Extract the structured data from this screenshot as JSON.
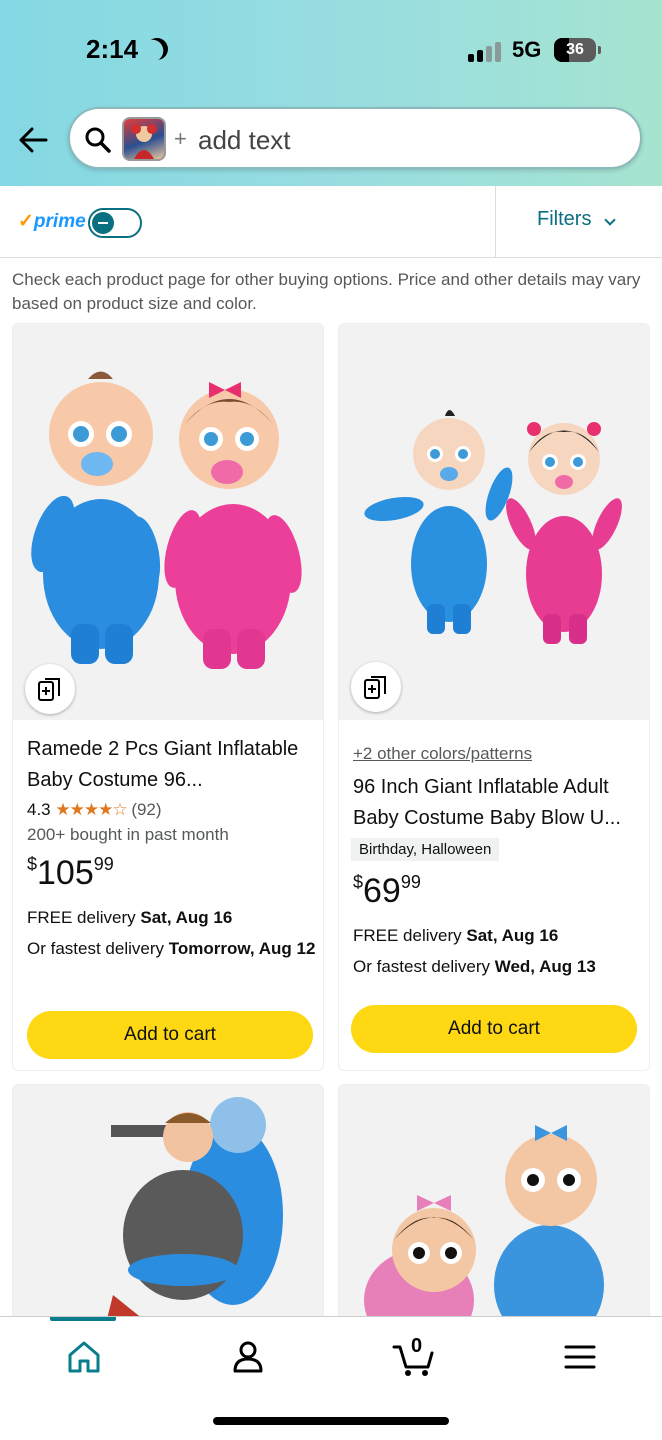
{
  "status_bar": {
    "time": "2:14",
    "network": "5G",
    "battery": "36"
  },
  "search": {
    "placeholder_text": "add text",
    "plus": "+"
  },
  "filter_bar": {
    "prime_label": "prime",
    "prime_check": "✓",
    "filters_label": "Filters"
  },
  "notice": "Check each product page for other buying options. Price and other details may vary based on product size and color.",
  "products": [
    {
      "title": "Ramede 2 Pcs Giant Inflatable Baby Costume 96...",
      "rating": "4.3",
      "stars": "★★★★☆",
      "review_count": "(92)",
      "bought": "200+ bought in past month",
      "price_symbol": "$",
      "price_whole": "105",
      "price_fraction": "99",
      "delivery_prefix": "FREE delivery ",
      "delivery_date": "Sat, Aug 16",
      "fastest_prefix": "Or fastest delivery ",
      "fastest_date": "Tomorrow, Aug 12",
      "cart_label": "Add to cart"
    },
    {
      "variants": "+2 other colors/patterns",
      "title": "96 Inch Giant Inflatable Adult Baby Costume Baby Blow U...",
      "tag": "Birthday, Halloween",
      "price_symbol": "$",
      "price_whole": "69",
      "price_fraction": "99",
      "delivery_prefix": "FREE delivery ",
      "delivery_date": "Sat, Aug 16",
      "fastest_prefix": "Or fastest delivery ",
      "fastest_date": "Wed, Aug 13",
      "cart_label": "Add to cart"
    }
  ],
  "cart_count": "0",
  "colors": {
    "accent_teal": "#0a6f80",
    "cart_button": "#ffd814",
    "star": "#de7921"
  }
}
